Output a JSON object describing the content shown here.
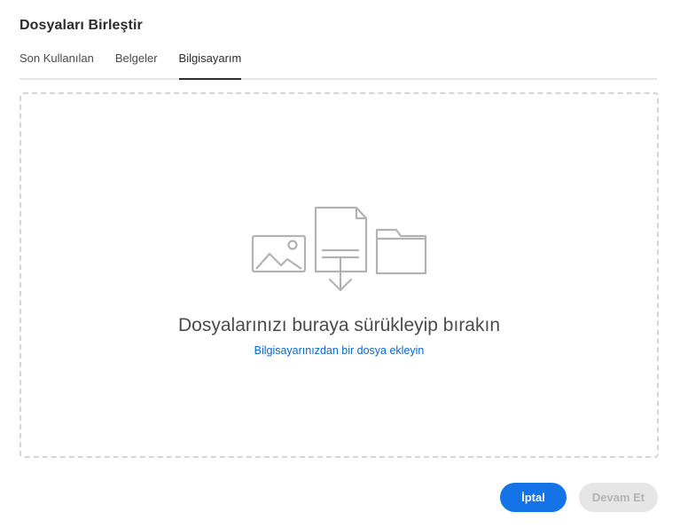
{
  "dialog": {
    "title": "Dosyaları Birleştir"
  },
  "tabs": [
    {
      "label": "Son Kullanılan",
      "active": false
    },
    {
      "label": "Belgeler",
      "active": false
    },
    {
      "label": "Bilgisayarım",
      "active": true
    }
  ],
  "dropzone": {
    "icons": [
      "image-icon",
      "document-download-icon",
      "folder-icon"
    ],
    "drop_text": "Dosyalarınızı buraya sürükleyip bırakın",
    "add_link": "Bilgisayarınızdan bir dosya ekleyin"
  },
  "buttons": {
    "cancel_label": "İptal",
    "continue_label": "Devam Et",
    "continue_disabled": true
  },
  "colors": {
    "accent": "#1473e6",
    "link": "#0d66d0",
    "disabled_bg": "#e6e6e6",
    "disabled_text": "#b3b3b3",
    "icon_gray": "#b3b3b3"
  }
}
